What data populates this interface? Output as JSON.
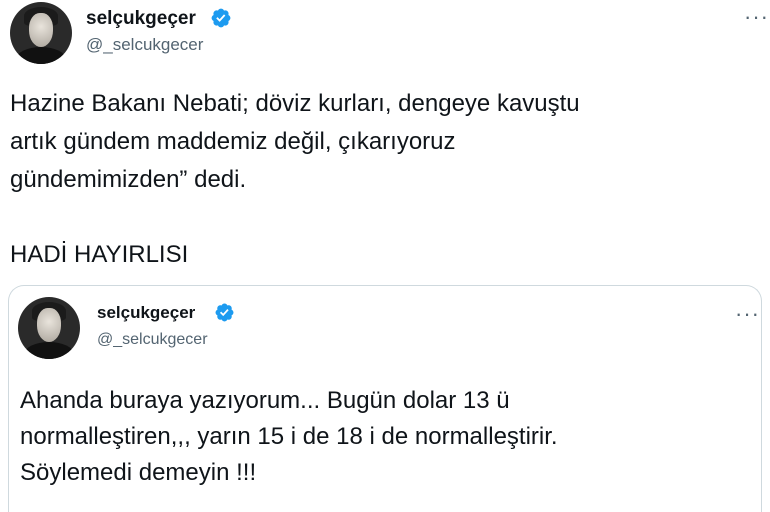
{
  "tweet": {
    "display_name": "selçukgeçer",
    "handle": "@_selcukgecer",
    "text": "Hazine  Bakanı Nebati; döviz kurları, dengeye kavuştu\nartık gündem maddemiz değil, çıkarıyoruz\ngündemimizden” dedi.",
    "text2": "HADİ HAYIRLISI",
    "more": "···"
  },
  "quoted": {
    "display_name": "selçukgeçer",
    "handle": "@_selcukgecer",
    "text": "Ahanda buraya yazıyorum... Bugün dolar 13 ü\nnormalleştiren,,, yarın 15 i de 18 i de normalleştirir.\nSöylemedi demeyin !!!",
    "more": "···"
  },
  "colors": {
    "verified": "#1d9bf0",
    "text": "#0f1419",
    "secondary": "#536471",
    "border": "#cfd9de"
  },
  "icons": [
    "avatar",
    "verified-badge-icon",
    "more-options-icon"
  ]
}
